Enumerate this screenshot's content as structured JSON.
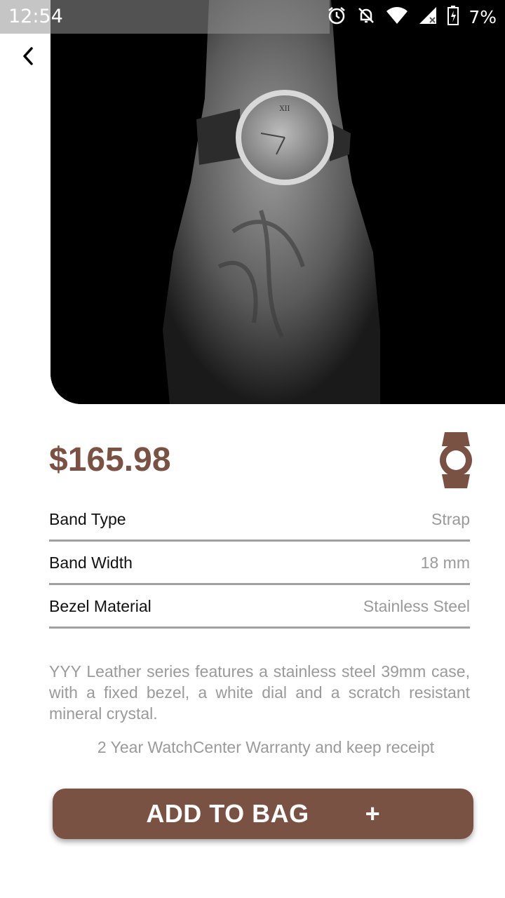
{
  "status_bar": {
    "time": "12:54",
    "battery_percent": "7%",
    "icons": [
      "alarm-icon",
      "notifications-off-icon",
      "wifi-icon",
      "cell-signal-icon",
      "battery-charging-icon"
    ]
  },
  "hero": {
    "image": "watch-on-wrist-photo"
  },
  "product": {
    "price": "$165.98",
    "specs": [
      {
        "label": "Band Type",
        "value": "Strap"
      },
      {
        "label": "Band Width",
        "value": "18 mm"
      },
      {
        "label": "Bezel Material",
        "value": "Stainless Steel"
      }
    ],
    "description": "YYY Leather series features a stainless steel 39mm case, with a fixed bezel, a white dial and a scratch resistant mineral crystal.",
    "warranty": "2 Year WatchCenter Warranty and keep receipt"
  },
  "cta": {
    "label": "ADD TO BAG",
    "plus": "+"
  },
  "colors": {
    "accent": "#7a5244",
    "muted_text": "#9a9a9a",
    "divider": "#a0a0a0"
  }
}
